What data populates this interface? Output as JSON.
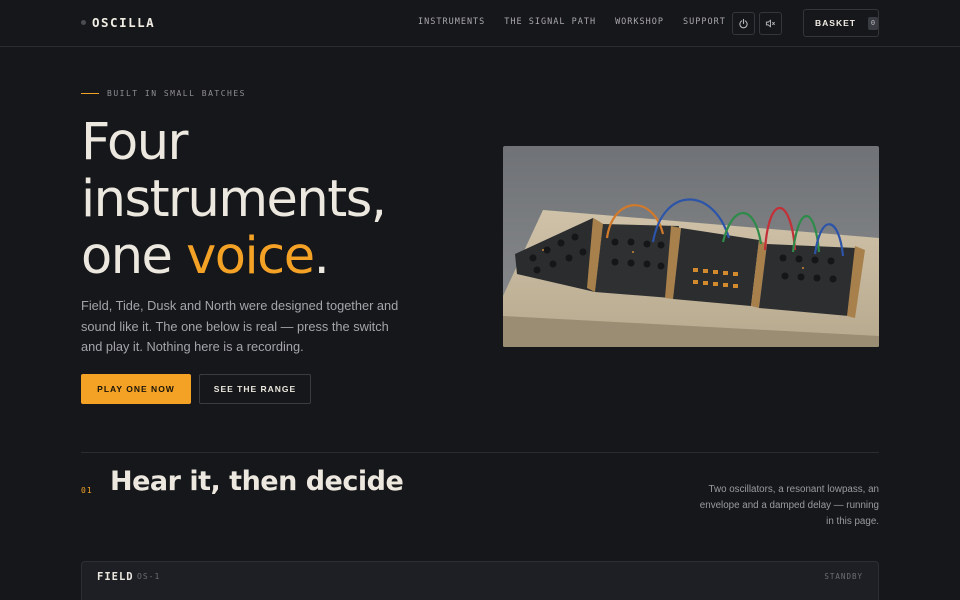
{
  "header": {
    "brand": "OSCILLA",
    "nav": [
      "INSTRUMENTS",
      "THE SIGNAL PATH",
      "WORKSHOP",
      "SUPPORT"
    ],
    "power_icon": "power-icon",
    "mute_icon": "speaker-mute-icon",
    "basket_label": "BASKET",
    "basket_count": "0"
  },
  "hero": {
    "eyebrow": "BUILT IN SMALL BATCHES",
    "headline_1": "Four",
    "headline_2": "instruments,",
    "headline_3a": "one ",
    "headline_3_accent": "voice",
    "headline_3b": ".",
    "lede": "Field, Tide, Dusk and North were designed together and sound like it. The one below is real — press the switch and play it. Nothing here is a recording.",
    "primary_cta": "PLAY ONE NOW",
    "secondary_cta": "SEE THE RANGE"
  },
  "section": {
    "number": "01",
    "title": "Hear it, then decide",
    "description": "Two oscillators, a resonant lowpass, an envelope and a damped delay — running in this page."
  },
  "instrument_panel": {
    "name": "FIELD",
    "code": "OS-1",
    "status": "STANDBY"
  },
  "colors": {
    "background": "#16171b",
    "accent": "#f4a226",
    "text": "#ece8df",
    "muted": "#a4a5aa"
  }
}
